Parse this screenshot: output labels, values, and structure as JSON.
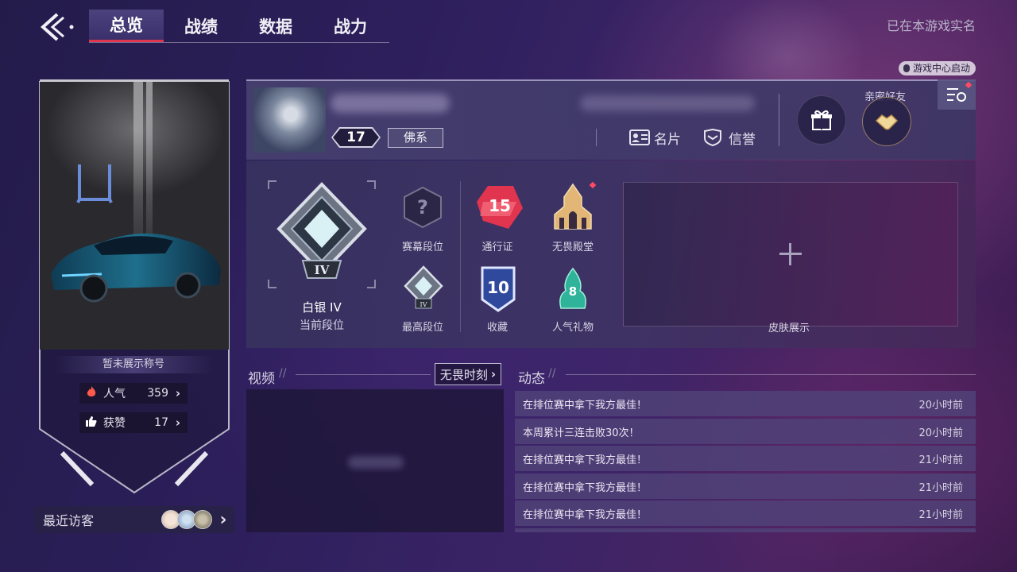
{
  "header": {
    "tabs": [
      {
        "label": "总览",
        "active": true
      },
      {
        "label": "战绩",
        "active": false
      },
      {
        "label": "数据",
        "active": false
      },
      {
        "label": "战力",
        "active": false
      }
    ],
    "realname_text": "已在本游戏实名",
    "game_center_badge": "游戏中心启动"
  },
  "sidebar": {
    "title_label": "暂未展示称号",
    "popularity": {
      "label": "人气",
      "value": "359"
    },
    "likes": {
      "label": "获赞",
      "value": "17"
    },
    "recent_visitors_label": "最近访客"
  },
  "profile": {
    "level": "17",
    "tag": "佛系",
    "card_label": "名片",
    "credit_label": "信誉",
    "intimate_friends_label": "亲密好友"
  },
  "ranks": {
    "current": {
      "tier_icon": "IV",
      "name": "白银 IV",
      "caption": "当前段位"
    },
    "season": {
      "icon": "?",
      "caption": "赛幕段位"
    },
    "highest": {
      "tier_icon": "IV",
      "caption": "最高段位"
    },
    "pass": {
      "value": "15",
      "caption": "通行证"
    },
    "hall": {
      "caption": "无畏殿堂"
    },
    "collection": {
      "value": "10",
      "caption": "收藏"
    },
    "gifts": {
      "value": "8",
      "caption": "人气礼物"
    },
    "skin_display": {
      "caption": "皮肤展示"
    }
  },
  "video": {
    "title": "视频",
    "moments_button": "无畏时刻"
  },
  "feed": {
    "title": "动态",
    "items": [
      {
        "text": "在排位赛中拿下我方最佳！",
        "time": "20小时前"
      },
      {
        "text": "本周累计三连击败30次！",
        "time": "20小时前"
      },
      {
        "text": "在排位赛中拿下我方最佳！",
        "time": "21小时前"
      },
      {
        "text": "在排位赛中拿下我方最佳！",
        "time": "21小时前"
      },
      {
        "text": "在排位赛中拿下我方最佳！",
        "time": "21小时前"
      }
    ]
  },
  "colors": {
    "accent_red": "#e0344f",
    "gold": "#e2b676",
    "panel": "#3a3466"
  }
}
